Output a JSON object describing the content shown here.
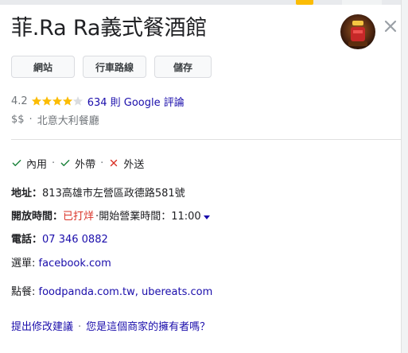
{
  "place": {
    "title": "菲.Ra Ra義式餐酒館",
    "rating_value": "4.2",
    "rating_stars": 4.2,
    "reviews_link": "634 則 Google 評論",
    "price": "$$",
    "category": "北意大利餐廳"
  },
  "actions": {
    "website": "網站",
    "directions": "行車路線",
    "save": "儲存"
  },
  "services": [
    {
      "label": "內用",
      "available": true
    },
    {
      "label": "外帶",
      "available": true
    },
    {
      "label": "外送",
      "available": false
    }
  ],
  "info": {
    "address_label": "地址",
    "address_value": "813高雄市左營區政德路581號",
    "hours_label": "開放時間",
    "hours_status": "已打烊",
    "hours_next": "開始營業時間：11:00",
    "phone_label": "電話",
    "phone_value": "07 346 0882",
    "menu_label": "選單",
    "menu_value": "facebook.com",
    "order_label": "點餐",
    "order_value": "foodpanda.com.tw, ubereats.com"
  },
  "footer": {
    "suggest_edit": "提出修改建議",
    "own_business": "您是這個商家的擁有者嗎？"
  },
  "colors": {
    "link": "#1a0dab",
    "star": "#fbbc04",
    "check": "#188038",
    "cross": "#d93025",
    "closed": "#d93025"
  },
  "icons": {
    "close": "close-icon",
    "star": "star-icon",
    "check": "check-icon",
    "cross": "cross-icon",
    "caret": "caret-down-icon"
  }
}
